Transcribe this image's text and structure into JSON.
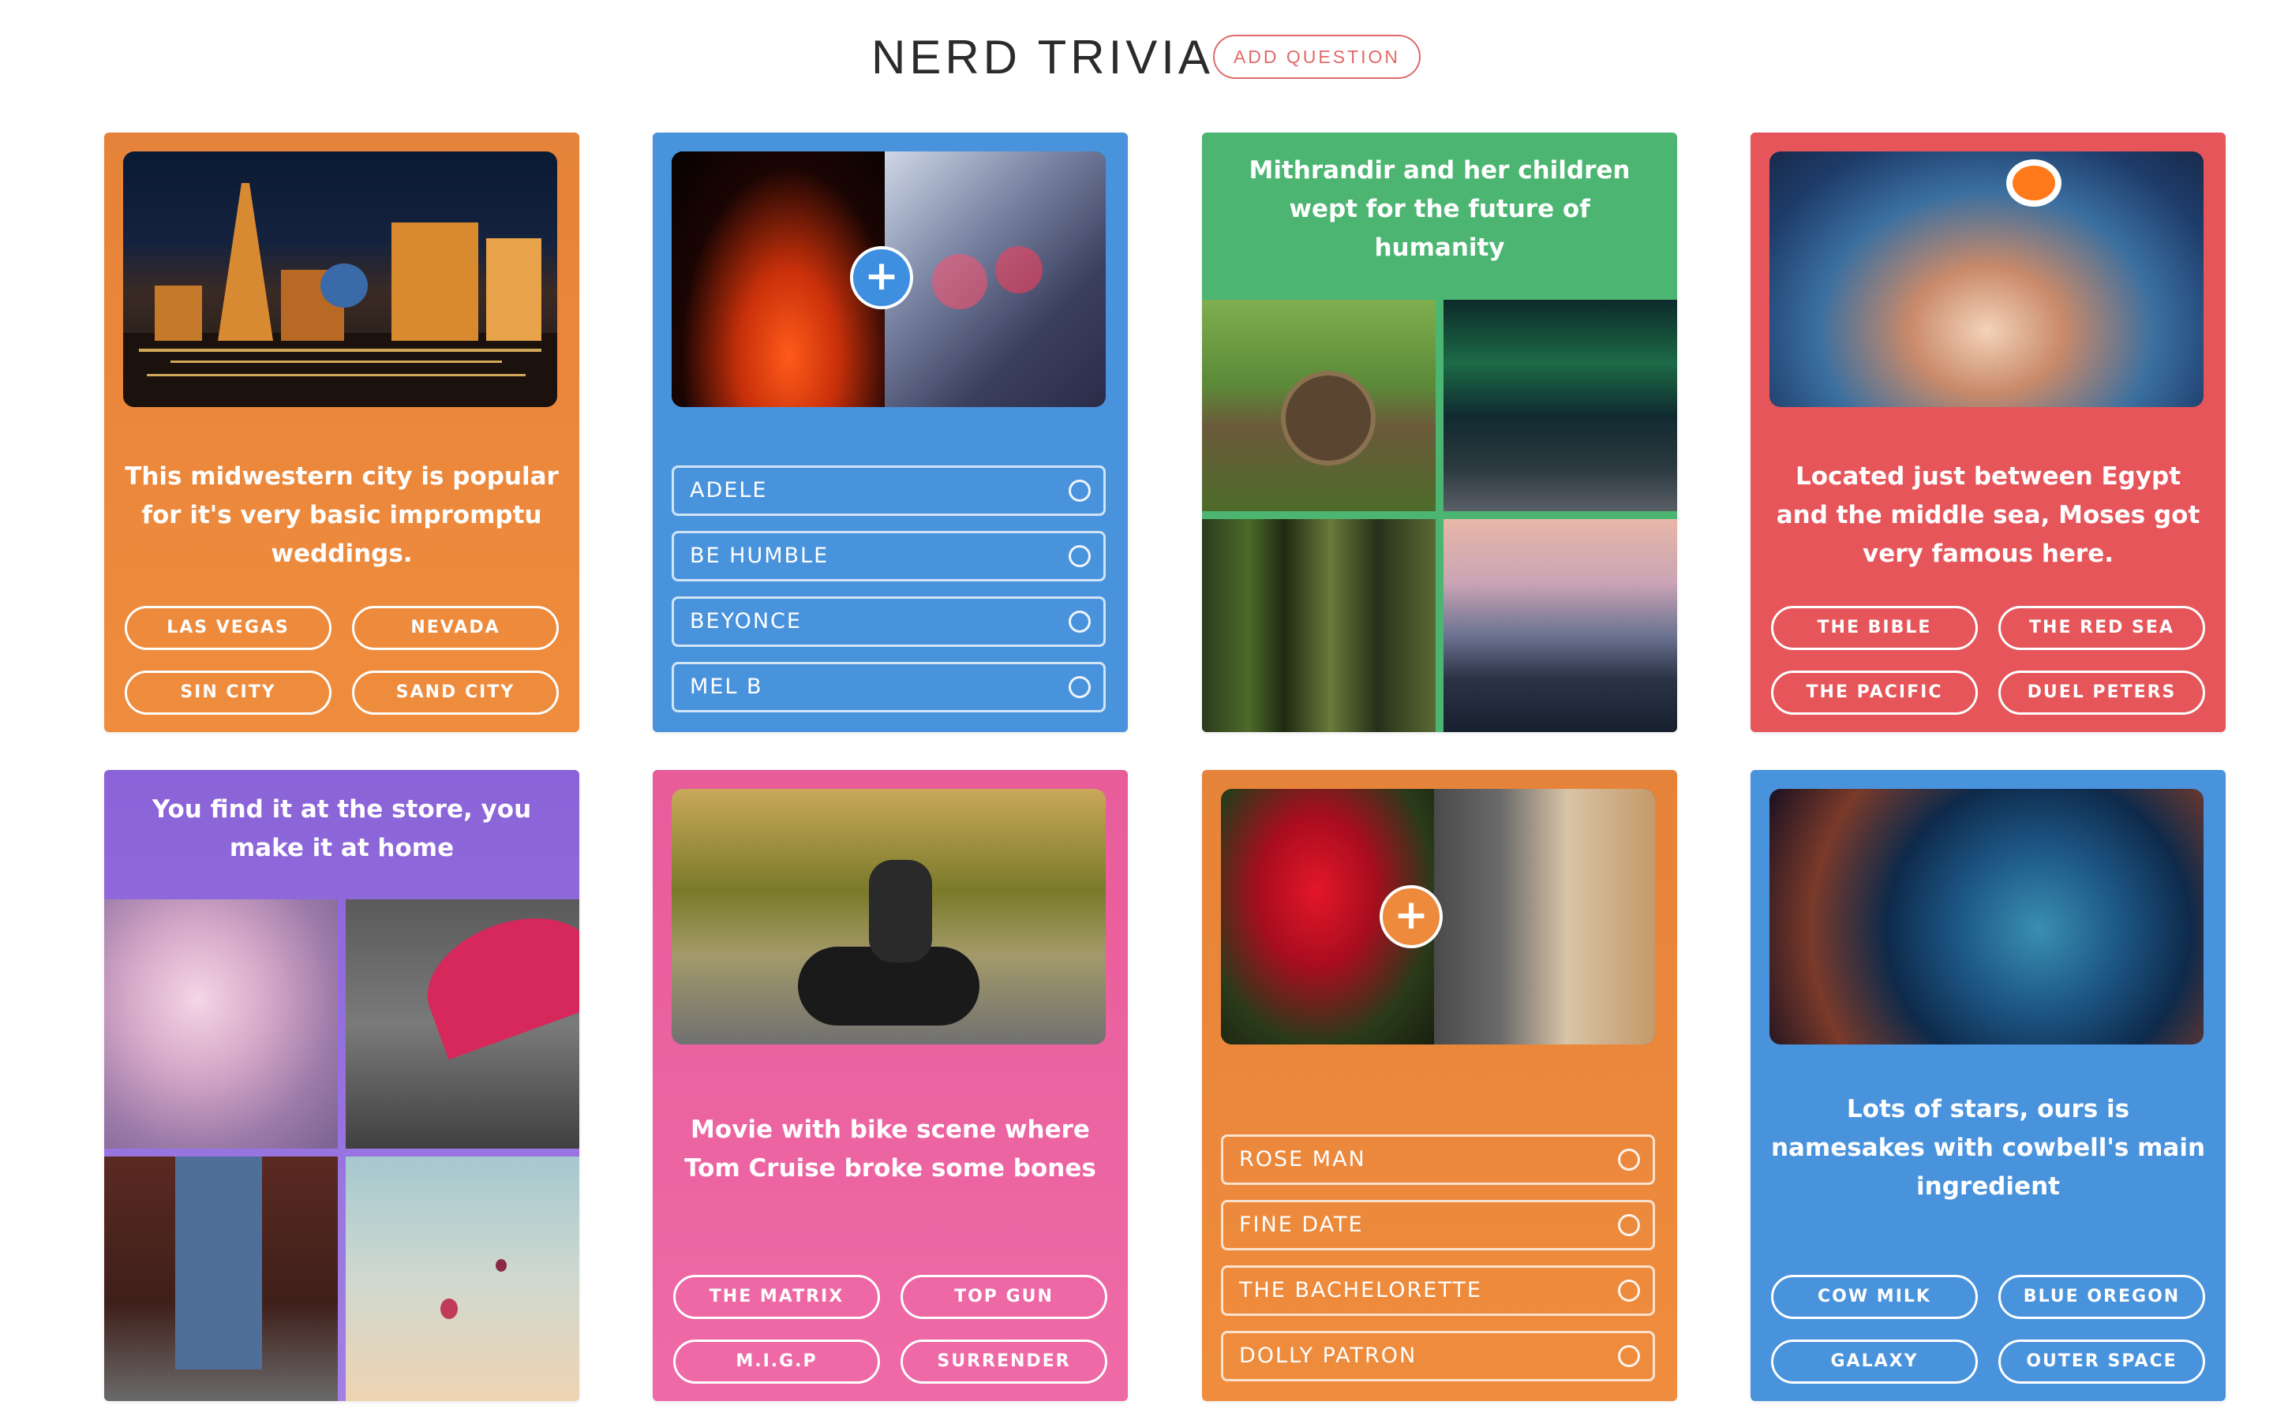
{
  "header": {
    "title": "NERD TRIVIA",
    "add_button": "ADD QUESTION"
  },
  "colors": {
    "orange": "#ee8a3c",
    "blue": "#4993dd",
    "green": "#4cb572",
    "red": "#e5555a",
    "purple": "#9570df",
    "pink": "#ea63a0",
    "accent": "#e06a6a"
  },
  "cards": [
    {
      "question": "This midwestern city is popular for it's very basic impromptu weddings.",
      "answers": [
        "LAS VEGAS",
        "NEVADA",
        "SIN CITY",
        "SAND CITY"
      ]
    },
    {
      "options": [
        "ADELE",
        "BE HUMBLE",
        "BEYONCE",
        "MEL B"
      ]
    },
    {
      "question": "Mithrandir and her children wept for the future of humanity"
    },
    {
      "question": "Located just between Egypt and the middle sea, Moses got very famous here.",
      "answers": [
        "THE BIBLE",
        "THE RED SEA",
        "THE PACIFIC",
        "DUEL PETERS"
      ]
    },
    {
      "question": "You find it at the store, you make it at home"
    },
    {
      "question": "Movie with bike scene where Tom Cruise broke some bones",
      "answers": [
        "THE MATRIX",
        "TOP GUN",
        "M.I.G.P",
        "SURRENDER"
      ]
    },
    {
      "options": [
        "ROSE MAN",
        "FINE DATE",
        "THE BACHELORETTE",
        "DOLLY PATRON"
      ]
    },
    {
      "question": "Lots of stars, ours is namesakes with cowbell's main ingredient",
      "answers": [
        "COW MILK",
        "BLUE OREGON",
        "GALAXY",
        "OUTER SPACE"
      ]
    }
  ],
  "icons": {
    "plus": "+",
    "add_media": "plus-icon",
    "radio": "radio-circle-icon"
  }
}
